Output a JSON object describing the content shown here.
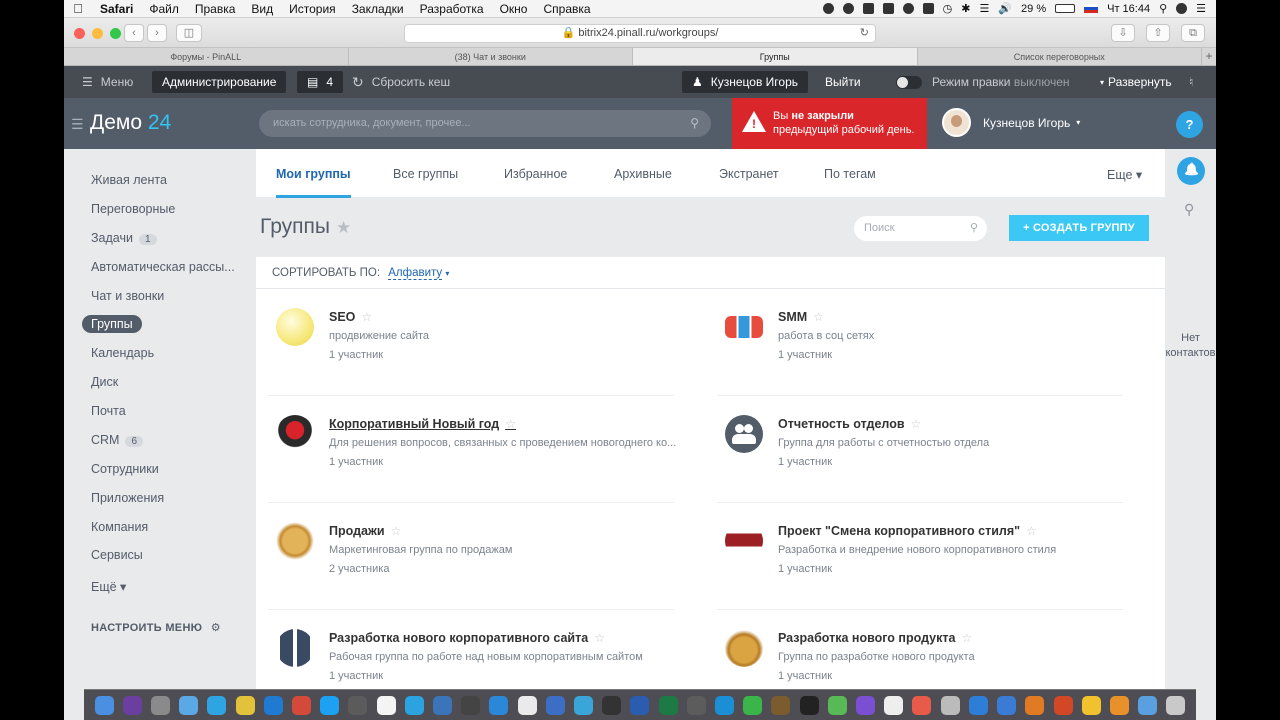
{
  "menubar": {
    "app": "Safari",
    "items": [
      "Файл",
      "Правка",
      "Вид",
      "История",
      "Закладки",
      "Разработка",
      "Окно",
      "Справка"
    ],
    "battery": "29 %",
    "clock": "Чт 16:44"
  },
  "browser": {
    "url": "bitrix24.pinall.ru/workgroups/",
    "tabs": [
      "Форумы - PinALL",
      "(38) Чат и звонки",
      "Группы",
      "Список переговорных"
    ]
  },
  "adminbar": {
    "menu": "Меню",
    "admin": "Администрирование",
    "notif_count": "4",
    "reset_cache": "Сбросить кеш",
    "user": "Кузнецов Игорь",
    "logout": "Выйти",
    "edit_mode_label": "Режим правки",
    "edit_mode_state": "выключен",
    "expand": "Развернуть"
  },
  "header": {
    "logo_text": "Демо",
    "logo_num": "24",
    "search_placeholder": "искать сотрудника, документ, прочее...",
    "alert_line1_pre": "Вы ",
    "alert_line1_bold": "не закрыли",
    "alert_line2": "предыдущий рабочий день.",
    "user_name": "Кузнецов Игорь",
    "help": "?"
  },
  "sidebar": {
    "items": [
      {
        "label": "Живая лента"
      },
      {
        "label": "Переговорные"
      },
      {
        "label": "Задачи",
        "count": "1"
      },
      {
        "label": "Автоматическая рассы..."
      },
      {
        "label": "Чат и звонки"
      },
      {
        "label": "Группы"
      },
      {
        "label": "Календарь"
      },
      {
        "label": "Диск"
      },
      {
        "label": "Почта"
      },
      {
        "label": "CRM",
        "count": "6"
      },
      {
        "label": "Сотрудники"
      },
      {
        "label": "Приложения"
      },
      {
        "label": "Компания"
      },
      {
        "label": "Сервисы"
      },
      {
        "label": "Ещё ▾"
      }
    ],
    "configure": "НАСТРОИТЬ МЕНЮ"
  },
  "subtabs": [
    "Мои группы",
    "Все группы",
    "Избранное",
    "Архивные",
    "Экстранет",
    "По тегам"
  ],
  "subtabs_more": "Еще ▾",
  "page": {
    "title": "Группы",
    "search_placeholder": "Поиск",
    "create_button": "+ СОЗДАТЬ ГРУППУ",
    "sort_label": "СОРТИРОВАТЬ ПО:",
    "sort_value": "Алфавиту"
  },
  "groups": [
    {
      "name": "SEO",
      "desc": "продвижение сайта",
      "members": "1 участник"
    },
    {
      "name": "SMM",
      "desc": "работа в соц сетях",
      "members": "1 участник"
    },
    {
      "name": "Корпоративный Новый год",
      "desc": "Для решения вопросов, связанных с проведением новогоднего ко...",
      "members": "1 участник"
    },
    {
      "name": "Отчетность отделов",
      "desc": "Группа для работы с отчетностью отдела",
      "members": "1 участник"
    },
    {
      "name": "Продажи",
      "desc": "Маркетинговая группа по продажам",
      "members": "2 участника"
    },
    {
      "name": "Проект \"Смена корпоративного стиля\"",
      "desc": "Разработка и внедрение нового корпоративного стиля",
      "members": "1 участник"
    },
    {
      "name": "Разработка нового корпоративного сайта",
      "desc": "Рабочая группа по работе над новым корпоративным сайтом",
      "members": "1 участник"
    },
    {
      "name": "Разработка нового продукта",
      "desc": "Группа по разработке нового продукта",
      "members": "1 участник"
    }
  ],
  "rail": {
    "no_contacts": "Нет контактов"
  },
  "colors": {
    "accent": "#2fa4e2",
    "header": "#535c69",
    "alert": "#d9262a",
    "create": "#3bc8f5"
  }
}
